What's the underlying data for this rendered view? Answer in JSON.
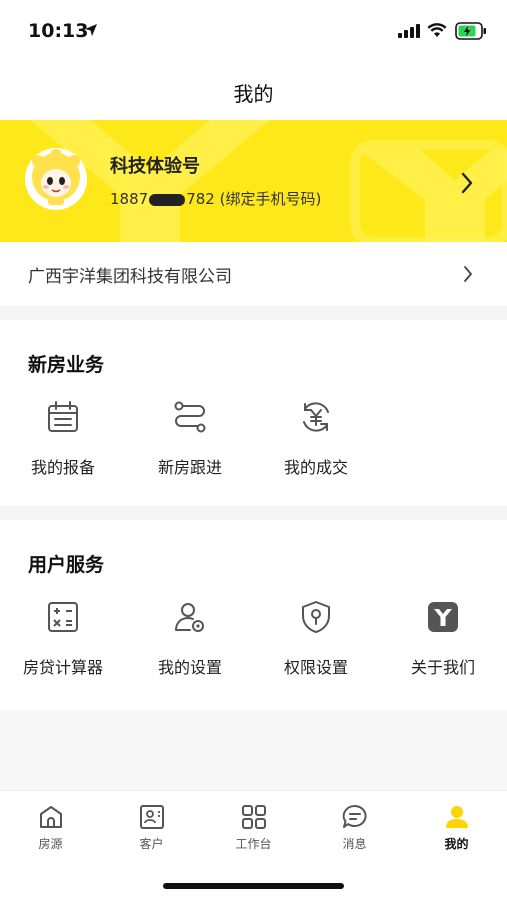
{
  "status_bar": {
    "time": "10:13"
  },
  "nav": {
    "title": "我的"
  },
  "profile": {
    "name": "科技体验号",
    "phone_prefix": "1887",
    "phone_suffix": "782 (绑定手机号码)"
  },
  "company": {
    "name": "广西宇洋集团科技有限公司"
  },
  "new_house": {
    "title": "新房业务",
    "items": [
      {
        "label": "我的报备",
        "icon": "calendar-icon"
      },
      {
        "label": "新房跟进",
        "icon": "route-icon"
      },
      {
        "label": "我的成交",
        "icon": "yuan-cycle-icon"
      }
    ]
  },
  "service": {
    "title": "用户服务",
    "items": [
      {
        "label": "房贷计算器",
        "icon": "calculator-icon"
      },
      {
        "label": "我的设置",
        "icon": "user-settings-icon"
      },
      {
        "label": "权限设置",
        "icon": "shield-key-icon"
      },
      {
        "label": "关于我们",
        "icon": "app-logo-icon"
      }
    ]
  },
  "tabbar": {
    "tabs": [
      {
        "label": "房源",
        "icon": "house-icon"
      },
      {
        "label": "客户",
        "icon": "contact-card-icon"
      },
      {
        "label": "工作台",
        "icon": "grid-icon"
      },
      {
        "label": "消息",
        "icon": "chat-icon"
      },
      {
        "label": "我的",
        "icon": "person-icon",
        "active": true
      }
    ]
  },
  "colors": {
    "brand_yellow": "#ffe81a",
    "active_icon": "#ffd400"
  }
}
